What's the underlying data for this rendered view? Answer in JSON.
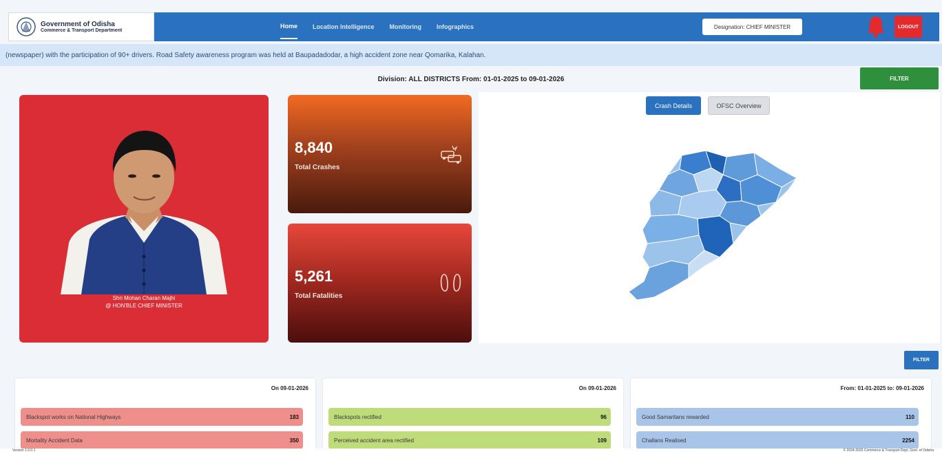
{
  "header": {
    "logo_line1": "Government of Odisha",
    "logo_line2": "Commerce & Transport Department",
    "nav": [
      "Home",
      "Location Intelligence",
      "Monitoring",
      "Infographics"
    ],
    "designation": "Designation: CHIEF MINISTER",
    "logout": "LOGOUT"
  },
  "ticker": "(newspaper) with the participation of 90+ drivers. Road Safety awareness program was held at Baupadadodar, a high accident zone near Qomarika, Kalahan.",
  "division": "Division: ALL DISTRICTS    From: 01-01-2025 to 09-01-2026",
  "filter_top": "FILTER",
  "cm": {
    "name": "Shri Mohan Charan Majhi",
    "title": "@ HON'BLE CHIEF MINISTER"
  },
  "stats": {
    "crashes": {
      "value": "8,840",
      "label": "Total Crashes"
    },
    "fatalities": {
      "value": "5,261",
      "label": "Total Fatalities"
    }
  },
  "map_tabs": {
    "crash": "Crash Details",
    "ofsc": "OFSC Overview"
  },
  "filter_bottom": "FILTER",
  "panels": [
    {
      "date": "On 09-01-2026",
      "rows": [
        {
          "label": "Blackspot works on National Highways",
          "value": "183"
        },
        {
          "label": "Mortality Accident Data",
          "value": "350"
        }
      ]
    },
    {
      "date": "On 09-01-2026",
      "rows": [
        {
          "label": "Blackspots rectified",
          "value": "96"
        },
        {
          "label": "Perceived accident area rectified",
          "value": "109"
        }
      ]
    },
    {
      "date": "From: 01-01-2025 to: 09-01-2026",
      "rows": [
        {
          "label": "Good Samaritans rewarded",
          "value": "110"
        },
        {
          "label": "Challans Realised",
          "value": "2254"
        }
      ]
    }
  ],
  "footer": {
    "left": "Version 1.0.0.1",
    "right": "© 2024-2025 Commerce & Transport Dept, Govt. of Odisha"
  },
  "colors": {
    "header_blue": "#2a72c0",
    "cm_red": "#db2d35",
    "filter_green": "#2e8f3c",
    "logout_red": "#e52a2e"
  },
  "icons": [
    "state-emblem-icon",
    "bell-icon",
    "crash-cars-icon",
    "footprints-icon"
  ]
}
